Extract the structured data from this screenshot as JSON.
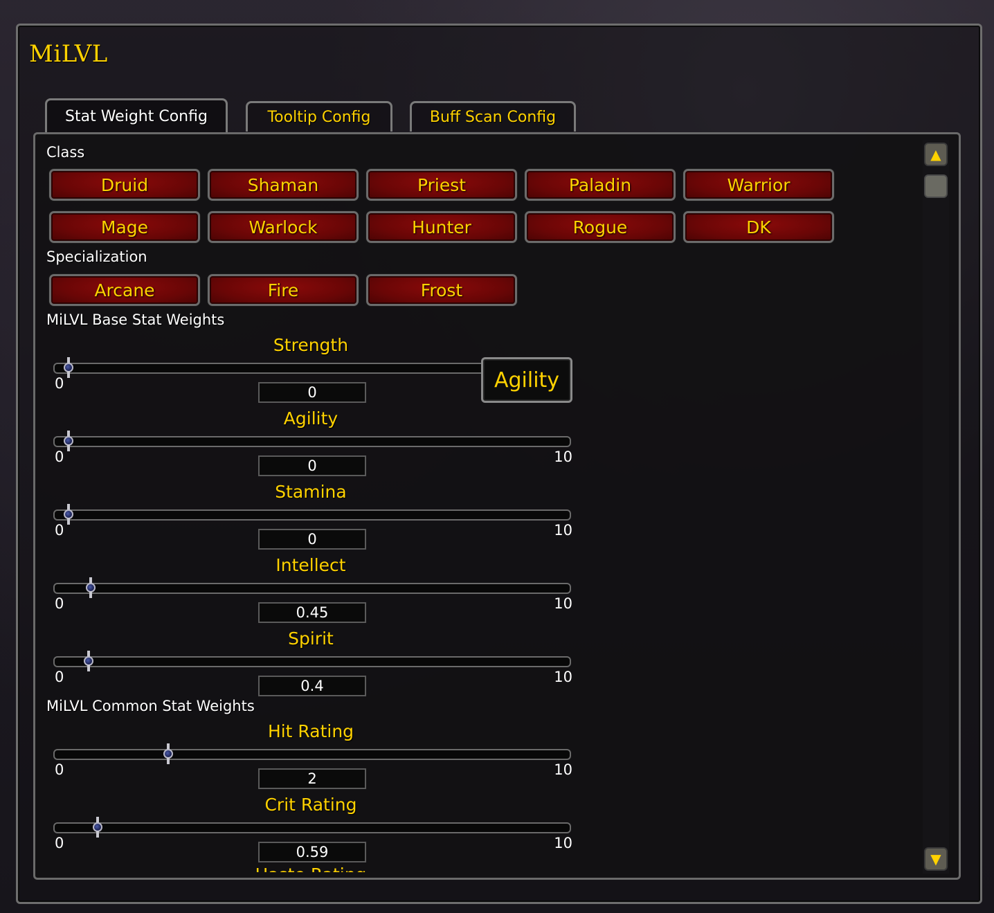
{
  "window": {
    "title": "MiLVL"
  },
  "tabs": [
    {
      "label": "Stat Weight Config",
      "active": true
    },
    {
      "label": "Tooltip Config",
      "active": false
    },
    {
      "label": "Buff Scan Config",
      "active": false
    }
  ],
  "class_section": {
    "label": "Class",
    "buttons": [
      "Druid",
      "Shaman",
      "Priest",
      "Paladin",
      "Warrior",
      "Mage",
      "Warlock",
      "Hunter",
      "Rogue",
      "DK"
    ]
  },
  "spec_section": {
    "label": "Specialization",
    "buttons": [
      "Arcane",
      "Fire",
      "Frost"
    ]
  },
  "base_stats": {
    "label": "MiLVL Base Stat Weights",
    "sliders": [
      {
        "name": "Strength",
        "value": "0",
        "min": "0",
        "max": "10",
        "fraction": 0.0
      },
      {
        "name": "Agility",
        "value": "0",
        "min": "0",
        "max": "10",
        "fraction": 0.0
      },
      {
        "name": "Stamina",
        "value": "0",
        "min": "0",
        "max": "10",
        "fraction": 0.0
      },
      {
        "name": "Intellect",
        "value": "0.45",
        "min": "0",
        "max": "10",
        "fraction": 0.045
      },
      {
        "name": "Spirit",
        "value": "0.4",
        "min": "0",
        "max": "10",
        "fraction": 0.04
      }
    ]
  },
  "common_stats": {
    "label": "MiLVL Common Stat Weights",
    "sliders": [
      {
        "name": "Hit Rating",
        "value": "2",
        "min": "0",
        "max": "10",
        "fraction": 0.2
      },
      {
        "name": "Crit Rating",
        "value": "0.59",
        "min": "0",
        "max": "10",
        "fraction": 0.059
      }
    ],
    "next_cutoff_label": "Haste Rating"
  },
  "tooltip": {
    "text": "Agility"
  },
  "scrollbar": {
    "up_icon": "scroll-up-arrow",
    "down_icon": "scroll-down-arrow",
    "position": 0.0
  }
}
